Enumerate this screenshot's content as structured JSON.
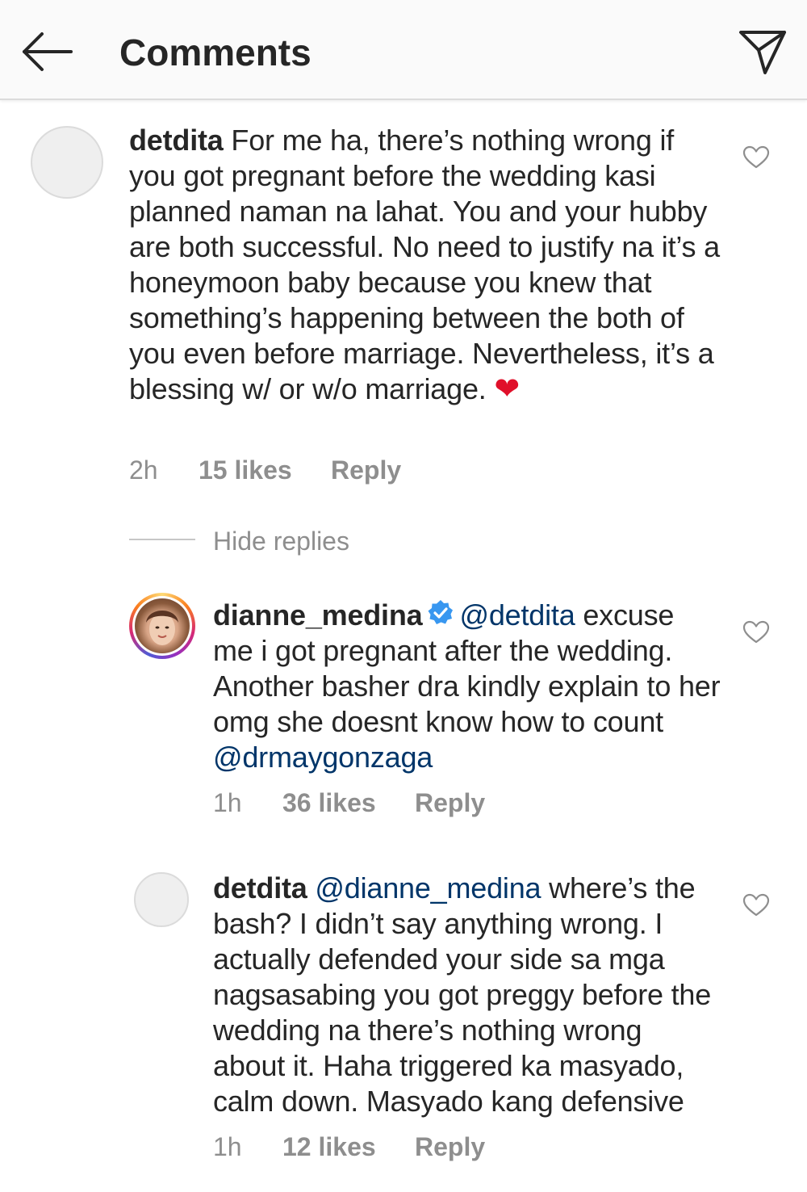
{
  "header": {
    "title": "Comments"
  },
  "comments": [
    {
      "username": "detdita",
      "text": " For me ha, there’s nothing wrong if you got pregnant before the wedding kasi planned naman na lahat. You and your hubby are both successful. No need to justify na it’s a honeymoon baby because you knew that something’s happening between the both of you even before marriage. Nevertheless, it’s a blessing w/ or w/o marriage. ",
      "emoji": "❤",
      "time": "2h",
      "likes": "15 likes",
      "reply": "Reply"
    }
  ],
  "hide_replies": "Hide replies",
  "replies": [
    {
      "username": "dianne_medina",
      "mention": "@detdita",
      "text": " excuse me i got pregnant after the wedding. Another basher dra kindly explain to her omg she doesnt know how to count ",
      "mention2": "@drmaygonzaga",
      "time": "1h",
      "likes": "36 likes",
      "reply": "Reply",
      "verified": true
    },
    {
      "username": "detdita",
      "mention": "@dianne_medina",
      "text": " where’s the bash? I didn’t say anything wrong. I actually defended your side sa mga nagsasabing you got preggy before the wedding na there’s nothing wrong about it. Haha triggered ka masyado, calm down. Masyado kang defensive",
      "time": "1h",
      "likes": "12 likes",
      "reply": "Reply"
    }
  ],
  "colors": {
    "text": "#262626",
    "muted": "#8e8e8e",
    "mention": "#003569",
    "verified": "#3897f0",
    "heart_emoji": "#e0102a"
  }
}
